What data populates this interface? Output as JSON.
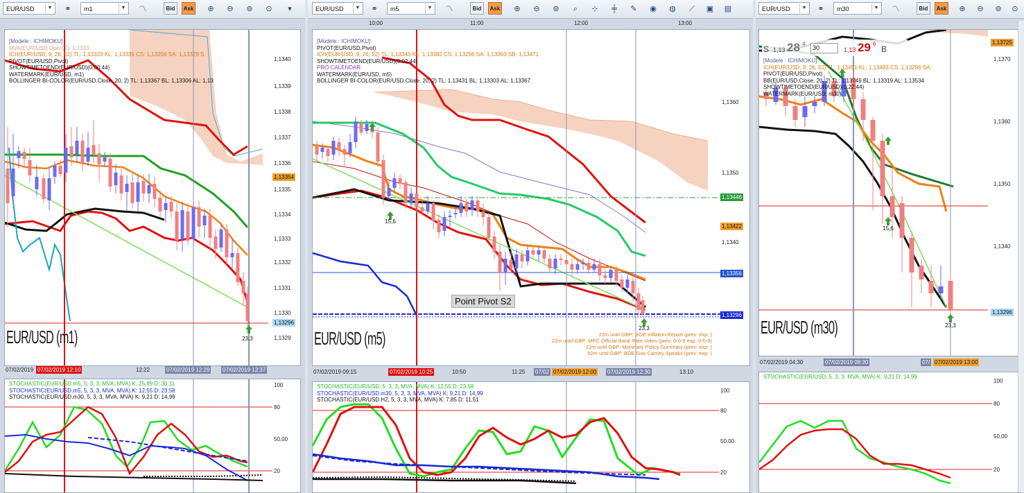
{
  "panels": [
    {
      "symbol": "EUR/USD",
      "timeframe": "m1",
      "bid_label": "Bid",
      "ask_label": "Ask",
      "legend": [
        {
          "text": "[Modele : ICHIMOKU]",
          "color": "#5a5a8a"
        },
        {
          "text": "MVA(EUR/USD.Open,7): 1,1333",
          "color": "#e0a080"
        },
        {
          "text": "ICH(EUR/USD, 9, 26, 52)  TL: 1,13323  KL: 1,13335  CS: 1,13296  SA: 1,13329  S",
          "color": "#d47a10"
        },
        {
          "text": "PIVOT(EUR/USD,Pivot)",
          "color": "#111"
        },
        {
          "text": "SHOWTIMETOEND(EUR/USD)(0:00:44)",
          "color": "#111"
        },
        {
          "text": "WATERMARK(EUR/USD, m1)",
          "color": "#111"
        },
        {
          "text": "BOLLINGER BI-COLOR(EUR/USD.Close, 20, 2)  TL: 1,13367  BL: 1,13306  AL: 1,13",
          "color": "#111"
        }
      ],
      "price_ticks": [
        "1,1340",
        "1,1339",
        "1,1338",
        "1,1337",
        "1,1336",
        "1,1335",
        "1,1334",
        "1,1333",
        "1,1332",
        "1,1331",
        "1,1330",
        "1,1329"
      ],
      "price_tags": [
        {
          "text": "1,13354",
          "bg": "#f0a030"
        },
        {
          "text": "1,13296",
          "bg": "#a9d8f5"
        }
      ],
      "watermark": "EUR/USD (m1)",
      "annotation": "23,3",
      "time_labels": [
        "07/02/2019",
        "07/02/2019 12:10",
        "12:22",
        "07/02/2019 12:29",
        "07/02/2019 12:37"
      ],
      "osc_legend": [
        {
          "text": "STOCHASTIC(EUR/USD.m5, 5, 3, 3, MVA, MVA)  K: 25,89  D: 30,11",
          "color": "#22bb22"
        },
        {
          "text": "STOCHASTIC(EUR/USD.m5, 5, 3, 3, MVA, MVA)  K: 12,55  D: 23,58",
          "color": "#1a2ad0"
        },
        {
          "text": "STOCHASTIC(EUR/USD.m30, 5, 3, 3, MVA, MVA)  K: 9,21  D: 14,99",
          "color": "#111"
        }
      ],
      "osc_ticks": [
        "100",
        "80",
        "50,00",
        "20"
      ]
    },
    {
      "symbol": "EUR/USD",
      "timeframe": "m5",
      "bid_label": "Bid",
      "ask_label": "Ask",
      "top_times": [
        "10:00",
        "11:00",
        "12:00",
        "13:00"
      ],
      "legend": [
        {
          "text": "[Modele : ICHIMOKU]",
          "color": "#5a5a8a"
        },
        {
          "text": "PIVOT(EUR/USD,Pivot)",
          "color": "#111"
        },
        {
          "text": "ICH(EUR/USD, 9, 26, 52)  TL: 1,13345  KL: 1,13382  CS: 1,13296  SA: 1,13363  SB: 1,13471",
          "color": "#d47a10"
        },
        {
          "text": "SHOWTIMETOEND(EUR/USD)(0:02:44)",
          "color": "#111"
        },
        {
          "text": "PRO CALENDAR",
          "color": "#8a3ac0"
        },
        {
          "text": "WATERMARK(EUR/USD, m5)",
          "color": "#111"
        },
        {
          "text": "BOLLINGER BI-COLOR(EUR/USD.Close, 20, 2)  TL: 1,13431  BL: 1,13303  AL: 1,13367",
          "color": "#111"
        }
      ],
      "price_ticks": [
        "1,1360",
        "1,1350",
        "1,1340"
      ],
      "price_tags": [
        {
          "text": "1,13446",
          "bg": "#2c9a3c"
        },
        {
          "text": "1,13422",
          "bg": "#f0a030"
        },
        {
          "text": "1,13356",
          "bg": "#2455d0"
        },
        {
          "text": "1,13296",
          "bg": "#1a2ad0"
        }
      ],
      "watermark": "EUR/USD (m5)",
      "annotations": [
        "15,6",
        "23,3"
      ],
      "pivot_label": "Point Pivot S2",
      "events": [
        "22m until GBP: BOE Inflation Report (prev:  exp: )",
        "22m until GBP: MPC Official Bank Rate Votes (prev: 0-0-9 exp: 0-0-9)",
        "22m until GBP: Monetary Policy Summary (prev:  exp: )",
        "52m until GBP: BOE Gov Carney Speaks (prev:  exp: )"
      ],
      "time_labels": [
        "07/02/2019 09:15",
        "07/02/2019 10:25",
        "10:50",
        "11:25",
        "07/02",
        "07/02/2019 12:00",
        "07/02/2019 12:30",
        "13:10"
      ],
      "osc_legend": [
        {
          "text": "STOCHASTIC(EUR/USD, 5, 3, 3, MVA, MVA)  K: 12,55  D: 23,58",
          "color": "#22bb22"
        },
        {
          "text": "STOCHASTIC(EUR/USD.m30, 5, 3, 3, MVA, MVA)  K: 9,21  D: 14,99",
          "color": "#1a2ad0"
        },
        {
          "text": "STOCHASTIC(EUR/USD.H2, 5, 3, 3, MVA, MVA)  K: 7,85  D: 11,51",
          "color": "#111"
        }
      ],
      "osc_ticks": [
        "100",
        "80",
        "50,00",
        "20"
      ]
    },
    {
      "symbol": "EUR/USD",
      "timeframe": "m30",
      "bid_label": "Bid",
      "ask_label": "Ask",
      "quote": {
        "sell_prefix": "S",
        "sell_small": "1,13",
        "sell_big": "28",
        "sell_sup": "4",
        "lot": "30",
        "buy_small": "1,13",
        "buy_big": "29",
        "buy_sup": "6",
        "buy_suffix": "B"
      },
      "legend": [
        {
          "text": "[Modele : ICHIMOKU]",
          "color": "#5a5a8a"
        },
        {
          "text": "ICH(EUR/USD, 9, 26, 52)  TL: 1,13451  KL: 1,13493  CS: 1,13296  SA:",
          "color": "#d47a10"
        },
        {
          "text": "PIVOT(EUR/USD,Pivot)",
          "color": "#111"
        },
        {
          "text": "BB(EUR/USD.Close, 20, 2)  TL: 1,13749  BL: 1,13319  AL: 1,13534",
          "color": "#111"
        },
        {
          "text": "SHOWTIMETOEND(EUR/USD)(0:22:44)",
          "color": "#111"
        },
        {
          "text": "WATERMARK(EUR/USD, m30)",
          "color": "#111"
        }
      ],
      "price_ticks": [
        "1,1370",
        "1,1360",
        "1,1350",
        "1,1340"
      ],
      "price_tags": [
        {
          "text": "1,13725",
          "bg": "#f0a030"
        },
        {
          "text": "1,13296",
          "bg": "#a9d8f5"
        }
      ],
      "watermark": "EUR/USD (m30)",
      "annotations": [
        "15,6",
        "23,3"
      ],
      "time_labels": [
        "07/02/2019 04:30",
        "07/02/2019 08:30",
        "07/",
        "07/02/2019 13:00"
      ],
      "osc_legend": [
        {
          "text": "STOCHASTIC(EUR/USD, 5, 3, 3, MVA, MVA)  K: 9,21  D: 14,99",
          "color": "#22bb22"
        }
      ],
      "osc_ticks": [
        "100",
        "80",
        "50,00",
        "20"
      ]
    }
  ],
  "colors": {
    "bull": "#6b6bf0",
    "bear": "#f08080",
    "kumo": "#f6d3c0",
    "tenkan": "#f08010",
    "kijun": "#20a020",
    "bb": "#e01010",
    "pivot": "#e02020",
    "blue": "#1a2ad0",
    "cursor": "#e01010",
    "grid": "#8a93b8"
  }
}
